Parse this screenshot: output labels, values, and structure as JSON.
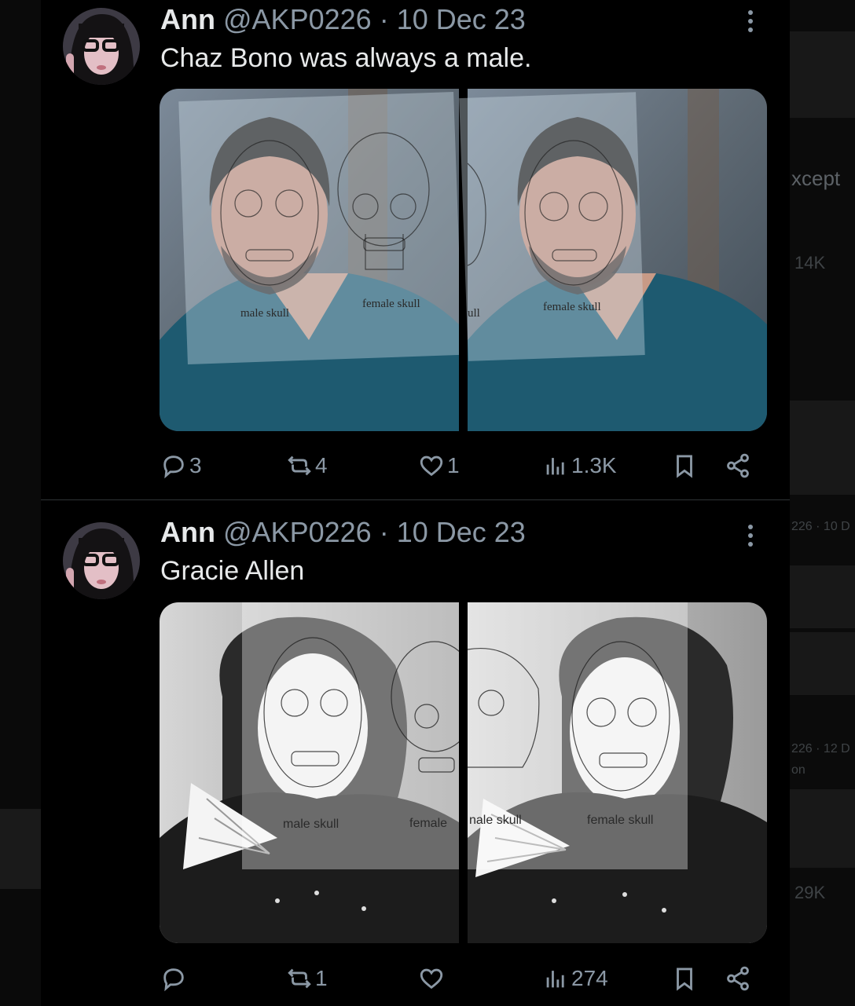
{
  "feed": {
    "tweets": [
      {
        "name": "Ann",
        "handle": "@AKP0226",
        "separator": "·",
        "date": "10 Dec 23",
        "text": "Chaz Bono was always a male.",
        "media": {
          "left_panel": {
            "label_left": "male skull",
            "label_right": "female skull"
          },
          "right_panel": {
            "label_left": "ull",
            "label_right": "female skull"
          }
        },
        "actions": {
          "replies": "3",
          "reposts": "4",
          "likes": "1",
          "views": "1.3K"
        }
      },
      {
        "name": "Ann",
        "handle": "@AKP0226",
        "separator": "·",
        "date": "10 Dec 23",
        "text": "Gracie Allen",
        "media": {
          "left_panel": {
            "label_left": "male skull",
            "label_right": "female"
          },
          "right_panel": {
            "label_left": "nale skull",
            "label_right": "female skull"
          }
        },
        "actions": {
          "replies": "",
          "reposts": "1",
          "likes": "",
          "views": "274"
        }
      }
    ]
  },
  "background_right": {
    "snippet_1": "xcept",
    "snippet_2": "14K",
    "snippet_3": "226 · 10 D",
    "snippet_4": "226 · 12 D",
    "snippet_5": "on",
    "snippet_6": "29K"
  },
  "colors": {
    "background": "#000000",
    "text_primary": "#e7e9ea",
    "text_secondary": "#8b98a5",
    "divider": "#2f3336"
  },
  "icons": [
    "reply-icon",
    "repost-icon",
    "like-icon",
    "views-icon",
    "bookmark-icon",
    "share-icon",
    "more-icon"
  ]
}
